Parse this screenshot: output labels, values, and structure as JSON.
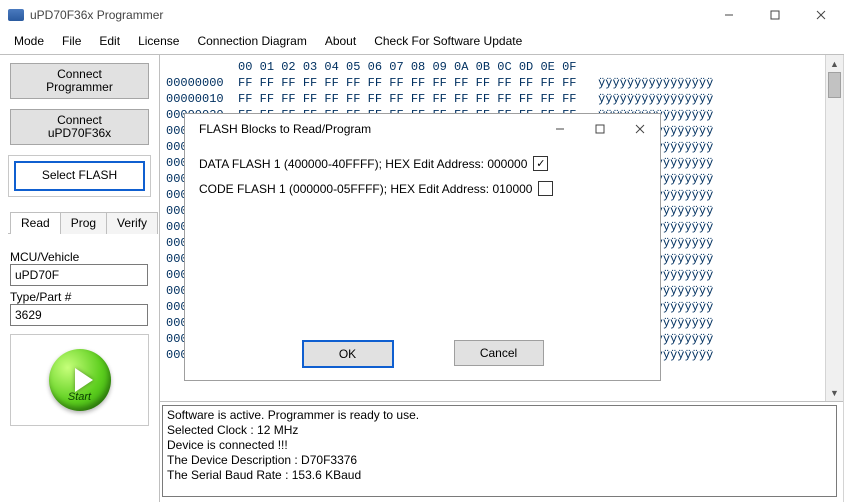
{
  "window": {
    "title": "uPD70F36x Programmer"
  },
  "menu": [
    "Mode",
    "File",
    "Edit",
    "License",
    "Connection Diagram",
    "About",
    "Check For Software Update"
  ],
  "left": {
    "connect_programmer": "Connect\nProgrammer",
    "connect_device": "Connect\nuPD70F36x",
    "select_flash": "Select FLASH",
    "tabs": {
      "read": "Read",
      "prog": "Prog",
      "verify": "Verify"
    },
    "mcu_label": "MCU/Vehicle",
    "mcu_value": "uPD70F",
    "type_label": "Type/Part #",
    "type_value": "3629",
    "start": "Start"
  },
  "hex": {
    "header_offsets": "00 01 02 03 04 05 06 07 08 09 0A 0B 0C 0D 0E 0F",
    "base": "00000000",
    "byte": "FF",
    "ascii": "ÿÿÿÿÿÿÿÿÿÿÿÿÿÿÿÿ",
    "rows": 18
  },
  "log": [
    "Software is active. Programmer is ready to use.",
    "Selected Clock : 12 MHz",
    "Device is connected !!!",
    "The Device Description : D70F3376",
    "The Serial Baud Rate : 153.6 KBaud"
  ],
  "modal": {
    "title": "FLASH Blocks to Read/Program",
    "rows": [
      {
        "label": "DATA FLASH 1 (400000-40FFFF); HEX Edit Address: 000000",
        "checked": true
      },
      {
        "label": "CODE FLASH 1 (000000-05FFFF); HEX Edit Address: 010000",
        "checked": false
      }
    ],
    "ok": "OK",
    "cancel": "Cancel"
  }
}
